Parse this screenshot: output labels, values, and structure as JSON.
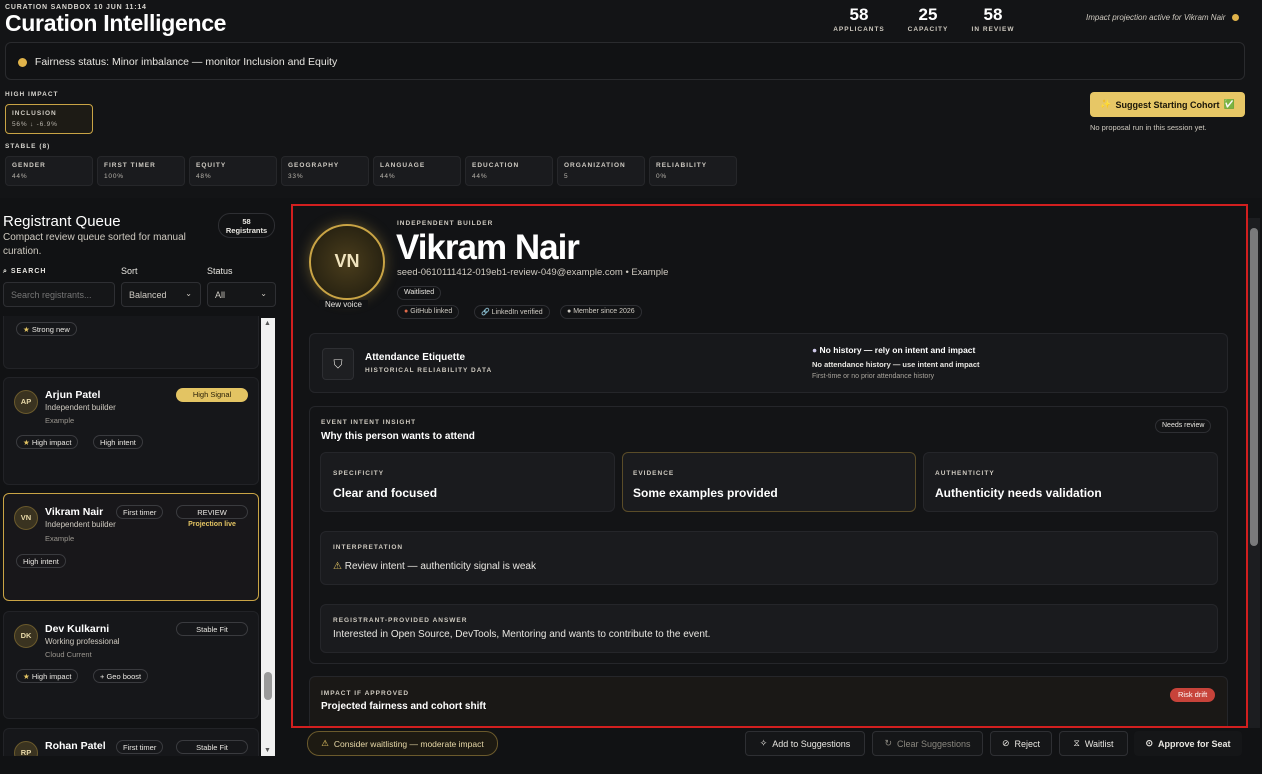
{
  "header": {
    "subtitle": "CURATION SANDBOX 10 JUN 11:14",
    "title": "Curation Intelligence",
    "stats": [
      {
        "value": "58",
        "label": "APPLICANTS"
      },
      {
        "value": "25",
        "label": "CAPACITY"
      },
      {
        "value": "58",
        "label": "IN REVIEW"
      }
    ],
    "projection_note": "Impact projection active for Vikram Nair"
  },
  "fairness": {
    "text": "Fairness status: Minor imbalance — monitor Inclusion and Equity"
  },
  "dimensions": {
    "high_label": "HIGH IMPACT",
    "high": {
      "name": "INCLUSION",
      "value": "56% ↓ -6.9%"
    },
    "stable_label": "STABLE (8)",
    "stable": [
      {
        "name": "GENDER",
        "value": "44%"
      },
      {
        "name": "FIRST TIMER",
        "value": "100%"
      },
      {
        "name": "EQUITY",
        "value": "48%"
      },
      {
        "name": "GEOGRAPHY",
        "value": "33%"
      },
      {
        "name": "LANGUAGE",
        "value": "44%"
      },
      {
        "name": "EDUCATION",
        "value": "44%"
      },
      {
        "name": "ORGANIZATION",
        "value": "5"
      },
      {
        "name": "RELIABILITY",
        "value": "0%"
      }
    ]
  },
  "suggest": {
    "label": "Suggest Starting Cohort",
    "note": "No proposal run in this session yet."
  },
  "queue": {
    "title": "Registrant Queue",
    "subtitle": "Compact review queue sorted for manual curation.",
    "count": "58",
    "count_label": "Registrants",
    "search_label": "SEARCH",
    "search_placeholder": "Search registrants...",
    "sort_label": "Sort",
    "sort_value": "Balanced",
    "status_label": "Status",
    "status_value": "All",
    "partial_tag": "Strong new",
    "cards": [
      {
        "initials": "AP",
        "name": "Arjun Patel",
        "role": "Independent builder",
        "org": "Example",
        "badge": "High Signal",
        "tags": [
          "High impact",
          "High intent"
        ]
      },
      {
        "initials": "VN",
        "name": "Vikram Nair",
        "first": "First timer",
        "role": "Independent builder",
        "org": "Example",
        "badge": "REVIEW",
        "badge2": "Projection live",
        "tags": [
          "High intent"
        ]
      },
      {
        "initials": "DK",
        "name": "Dev Kulkarni",
        "role": "Working professional",
        "org": "Cloud Current",
        "badge": "Stable Fit",
        "tags": [
          "High impact",
          "+ Geo boost"
        ]
      },
      {
        "initials": "RP",
        "name": "Rohan Patel",
        "first": "First timer",
        "badge": "Stable Fit"
      }
    ]
  },
  "profile": {
    "initials": "VN",
    "new_voice": "New voice",
    "type": "INDEPENDENT BUILDER",
    "name": "Vikram Nair",
    "email": "seed-0610111412-019eb1-review-049@example.com • Example",
    "status": "Waitlisted",
    "links": [
      "GitHub linked",
      "LinkedIn verified",
      "Member since 2026"
    ]
  },
  "attendance": {
    "title": "Attendance Etiquette",
    "sub": "HISTORICAL RELIABILITY DATA",
    "headline": "No history — rely on intent and impact",
    "line2": "No attendance history — use intent and impact",
    "line3": "First-time or no prior attendance history"
  },
  "intent": {
    "label": "EVENT INTENT INSIGHT",
    "title": "Why this person wants to attend",
    "badge": "Needs review",
    "cards": [
      {
        "label": "SPECIFICITY",
        "value": "Clear and focused"
      },
      {
        "label": "EVIDENCE",
        "value": "Some examples provided"
      },
      {
        "label": "AUTHENTICITY",
        "value": "Authenticity needs validation"
      }
    ],
    "interp_label": "INTERPRETATION",
    "interp": "Review intent — authenticity signal is weak",
    "answer_label": "REGISTRANT-PROVIDED ANSWER",
    "answer": "Interested in Open Source, DevTools, Mentoring and wants to contribute to the event."
  },
  "impact": {
    "label": "IMPACT IF APPROVED",
    "title": "Projected fairness and cohort shift",
    "badge": "Risk drift"
  },
  "actions": {
    "warning": "Consider waitlisting — moderate impact",
    "add": "Add to Suggestions",
    "clear": "Clear Suggestions",
    "reject": "Reject",
    "waitlist": "Waitlist",
    "approve": "Approve for Seat"
  }
}
